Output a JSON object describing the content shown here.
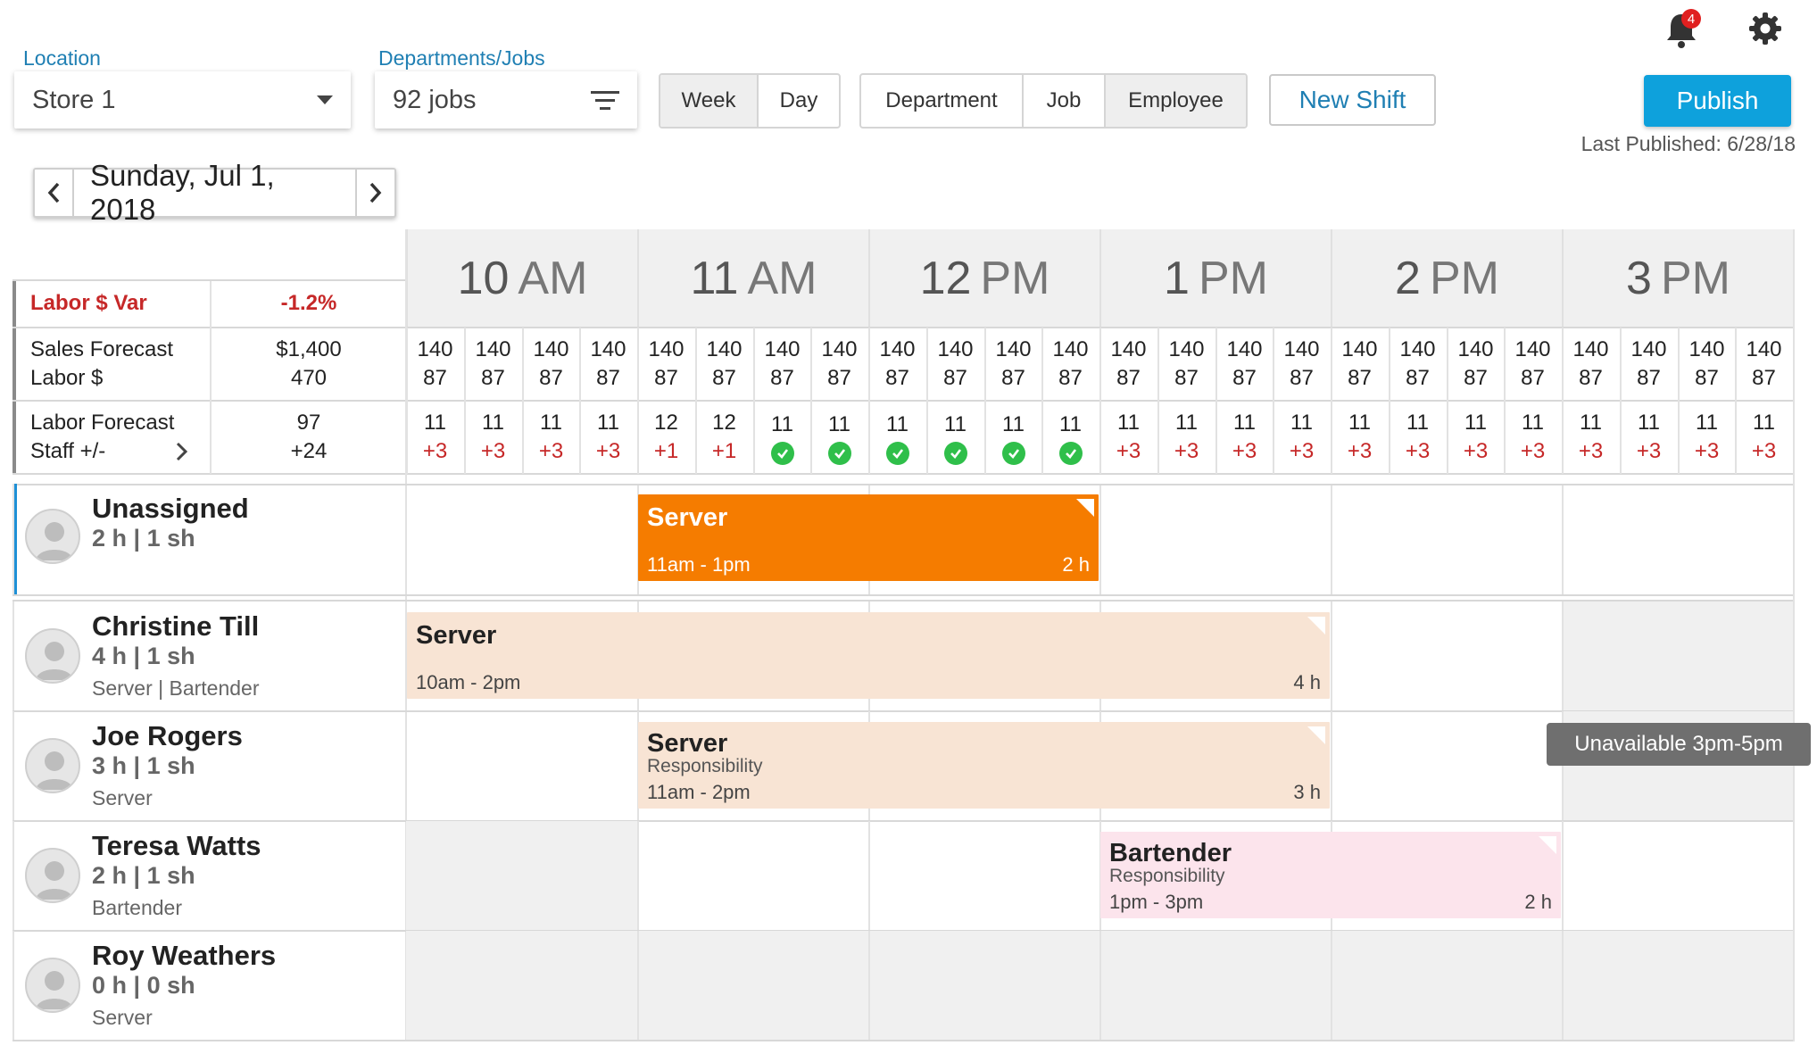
{
  "header": {
    "location_label": "Location",
    "location_value": "Store 1",
    "departments_label": "Departments/Jobs",
    "departments_value": "92 jobs",
    "view_toggle": [
      "Week",
      "Day"
    ],
    "group_toggle": [
      "Department",
      "Job",
      "Employee"
    ],
    "new_shift_label": "New Shift",
    "publish_label": "Publish",
    "last_published": "Last Published: 6/28/18",
    "notification_count": "4"
  },
  "date_nav": {
    "prev_icon": "chevron-left",
    "date": "Sunday, Jul 1, 2018",
    "next_icon": "chevron-right"
  },
  "hours": [
    {
      "num": "10",
      "ampm": "AM"
    },
    {
      "num": "11",
      "ampm": "AM"
    },
    {
      "num": "12",
      "ampm": "PM"
    },
    {
      "num": "1",
      "ampm": "PM"
    },
    {
      "num": "2",
      "ampm": "PM"
    },
    {
      "num": "3",
      "ampm": "PM"
    }
  ],
  "metrics": {
    "labor_var_label": "Labor $ Var",
    "labor_var_value": "-1.2%",
    "sales_forecast_label": "Sales Forecast",
    "labor_dollar_label": "Labor $",
    "sales_forecast_value": "$1,400",
    "labor_dollar_value": "470",
    "labor_forecast_label": "Labor Forecast",
    "staff_label": "Staff +/-",
    "labor_forecast_value": "97",
    "staff_value": "+24",
    "slots_sales": [
      "140",
      "140",
      "140",
      "140",
      "140",
      "140",
      "140",
      "140",
      "140",
      "140",
      "140",
      "140",
      "140",
      "140",
      "140",
      "140",
      "140",
      "140",
      "140",
      "140",
      "140",
      "140",
      "140",
      "140"
    ],
    "slots_labor": [
      "87",
      "87",
      "87",
      "87",
      "87",
      "87",
      "87",
      "87",
      "87",
      "87",
      "87",
      "87",
      "87",
      "87",
      "87",
      "87",
      "87",
      "87",
      "87",
      "87",
      "87",
      "87",
      "87",
      "87"
    ],
    "slots_forecast": [
      "11",
      "11",
      "11",
      "11",
      "12",
      "12",
      "11",
      "11",
      "11",
      "11",
      "11",
      "11",
      "11",
      "11",
      "11",
      "11",
      "11",
      "11",
      "11",
      "11",
      "11",
      "11",
      "11",
      "11"
    ],
    "slots_staff": [
      "+3",
      "+3",
      "+3",
      "+3",
      "+1",
      "+1",
      "check",
      "check",
      "check",
      "check",
      "check",
      "check",
      "+3",
      "+3",
      "+3",
      "+3",
      "+3",
      "+3",
      "+3",
      "+3",
      "+3",
      "+3",
      "+3",
      "+3"
    ]
  },
  "employees": [
    {
      "name": "Unassigned",
      "hours": "2 h | 1 sh",
      "role": ""
    },
    {
      "name": "Christine Till",
      "hours": "4 h | 1 sh",
      "role": "Server | Bartender"
    },
    {
      "name": "Joe Rogers",
      "hours": "3 h | 1 sh",
      "role": "Server"
    },
    {
      "name": "Teresa Watts",
      "hours": "2 h | 1 sh",
      "role": "Bartender"
    },
    {
      "name": "Roy Weathers",
      "hours": "0 h | 0 sh",
      "role": "Server"
    }
  ],
  "shifts": [
    {
      "title": "Server",
      "subtitle": "",
      "time": "11am - 1pm",
      "duration": "2 h",
      "color": "#f57c00"
    },
    {
      "title": "Server",
      "subtitle": "",
      "time": "10am - 2pm",
      "duration": "4 h",
      "color": "#f8e4d4"
    },
    {
      "title": "Server",
      "subtitle": "Responsibility",
      "time": "11am - 2pm",
      "duration": "3 h",
      "color": "#f8e4d4"
    },
    {
      "title": "Bartender",
      "subtitle": "Responsibility",
      "time": "1pm - 3pm",
      "duration": "2 h",
      "color": "#fce4ec"
    }
  ],
  "tooltip": "Unavailable 3pm-5pm",
  "colors": {
    "accent": "#0ea1dc",
    "link": "#1f7fb3",
    "negative": "#c62828",
    "ok": "#2fbf4a",
    "unassigned_bar": "#1e90d6"
  },
  "icons": [
    "bell-icon",
    "gear-icon",
    "caret-down-icon",
    "filter-icon",
    "chevron-left-icon",
    "chevron-right-icon",
    "check-circle-icon",
    "avatar-icon"
  ]
}
